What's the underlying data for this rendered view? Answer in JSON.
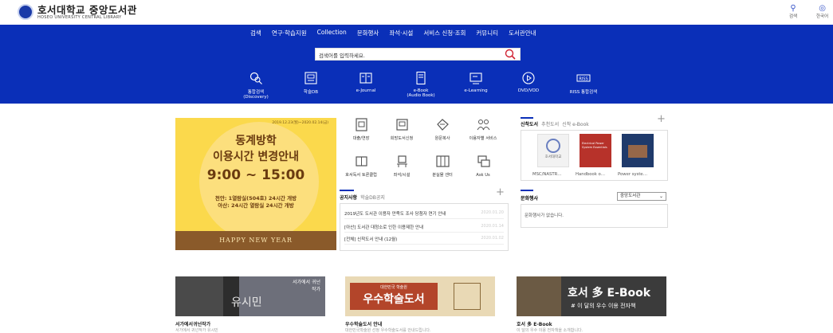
{
  "header": {
    "title_ko": "호서대학교 중앙도서관",
    "title_en": "HOSEO UNIVERSITY CENTRAL LIBRARY",
    "search_label": "검색",
    "lang_label": "한국어"
  },
  "gnb": [
    "검색",
    "연구·학습지원",
    "Collection",
    "문화행사",
    "좌석·시설",
    "서비스 신청·조회",
    "커뮤니티",
    "도서관안내"
  ],
  "search": {
    "placeholder": "검색어를 입력하세요."
  },
  "services": [
    {
      "label": "통합검색",
      "sub": "(Discovery)",
      "icon": "integrated-search-icon"
    },
    {
      "label": "학술DB",
      "sub": "",
      "icon": "database-icon"
    },
    {
      "label": "e-Journal",
      "sub": "",
      "icon": "journal-icon"
    },
    {
      "label": "e-Book",
      "sub": "(Audio Book)",
      "icon": "ebook-icon"
    },
    {
      "label": "e-Learning",
      "sub": "",
      "icon": "elearning-icon"
    },
    {
      "label": "DVD/VOD",
      "sub": "",
      "icon": "play-icon"
    },
    {
      "label": "RISS 통합검색",
      "sub": "",
      "icon": "riss-icon"
    }
  ],
  "banner": {
    "date": "2019.12.23(월)~2020.02.14(금)",
    "line1": "동계방학",
    "line2": "이용시간 변경안내",
    "time": "9:00 ~ 15:00",
    "note1": "천안: 1열람실(504호) 24시간 개방",
    "note2": "아산: 24시간 열람실 24시간 개방",
    "footer": "HAPPY NEW YEAR"
  },
  "quick": [
    {
      "label": "대출/연장",
      "icon": "loan-icon"
    },
    {
      "label": "희망도서신청",
      "icon": "request-book-icon"
    },
    {
      "label": "원문복사",
      "icon": "copy-icon"
    },
    {
      "label": "이용자별 서비스",
      "icon": "users-icon"
    },
    {
      "label": "호서독서 토론클럽",
      "icon": "reading-club-icon"
    },
    {
      "label": "좌석/시설",
      "icon": "seat-icon"
    },
    {
      "label": "분실물 센터",
      "icon": "lost-found-icon"
    },
    {
      "label": "Ask Us",
      "icon": "ask-icon"
    }
  ],
  "notice": {
    "tabs": [
      "공지사항",
      "학술DB공지"
    ],
    "rows": [
      {
        "title": "2019년도 도서관 이용자 만족도 조사 당첨자 연기 안내",
        "date": "2020.01.20"
      },
      {
        "title": "[아산] 도서관 대청소로 인한 이용제한 안내",
        "date": "2020.01.14"
      },
      {
        "title": "[전체] 신착도서 안내 (12월)",
        "date": "2020.01.02"
      }
    ]
  },
  "books": {
    "tabs": [
      "신착도서",
      "추천도서",
      "신착 e-Book"
    ],
    "items": [
      {
        "caption": "MSC/NASTR…",
        "cover_color": "#f2f2f2"
      },
      {
        "caption": "Handbook o…",
        "cover_color": "#b7322a"
      },
      {
        "caption": "Power syste…",
        "cover_color": "#1f3a6b"
      }
    ],
    "cover_text": "호서대학교",
    "cover2_text": "Electrical Power System Essentials"
  },
  "culture": {
    "tab": "문화행사",
    "select": "중앙도서관",
    "empty": "문화행사가 없습니다."
  },
  "cards": [
    {
      "title": "서가에서귀넌작가",
      "desc": "서가에서 귀넌작가 유시민",
      "img_text": "유시민",
      "corner": "서가에서 귀넌 작가"
    },
    {
      "title": "우수학술도서 안내",
      "desc": "대한민국학술원 선정 우수학술도서를 안내드립니다.",
      "img_top": "대한민국 학술원",
      "img_text": "우수학술도서"
    },
    {
      "title": "호서 多 E-Book",
      "desc": "이 달의 우수 이용 전자책을 소개합니다.",
      "img_text": "호서 多 E-Book",
      "img_sub": "# 이 달의 우수 이용 전자책"
    }
  ]
}
